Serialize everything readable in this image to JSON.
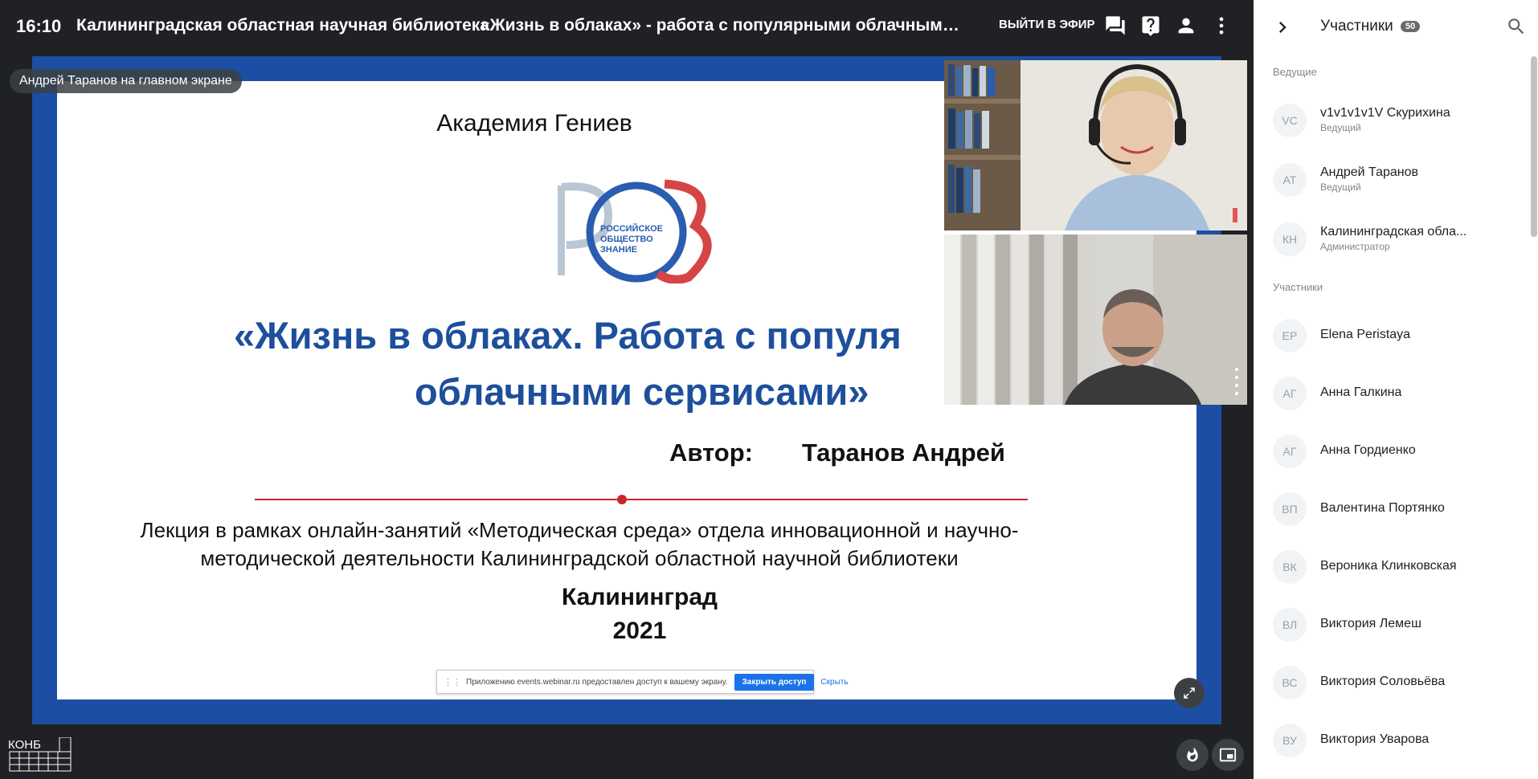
{
  "topbar": {
    "time": "16:10",
    "organization": "Калининградская областная научная библиотека",
    "event_title": "«Жизнь в облаках» - работа с популярными облачными сер...",
    "go_live": "ВЫЙТИ В ЭФИР",
    "icons": [
      "chat-icon",
      "question-icon",
      "person-icon",
      "more-vert-icon"
    ]
  },
  "stage": {
    "presenter_badge": "Андрей Таранов на главном экране",
    "slide": {
      "academy": "Академия Гениев",
      "logo_text": [
        "РОССИЙСКОЕ",
        "ОБЩЕСТВО",
        "ЗНАНИЕ"
      ],
      "title_line1": "«Жизнь в облаках. Работа с популя",
      "title_line2": "облачными сервисами»",
      "author_label": "Автор:",
      "author": "Таранов Андрей",
      "lecture": "Лекция в рамках онлайн-занятий «Методическая среда» отдела инновационной и научно-методической деятельности Калининградской областной научной библиотеки",
      "city": "Калининград",
      "year": "2021"
    },
    "share_bar": {
      "text": "Приложению events.webinar.ru предоставлен доступ к вашему экрану.",
      "stop": "Закрыть доступ",
      "hide": "Скрыть"
    }
  },
  "footer": {
    "logo_text": "КОНБ"
  },
  "sidebar": {
    "title": "Участники",
    "count": "50",
    "hosts_label": "Ведущие",
    "participants_label": "Участники",
    "hosts": [
      {
        "initials": "VC",
        "name": "v1v1v1v1V Скурихина",
        "role": "Ведущий"
      },
      {
        "initials": "АТ",
        "name": "Андрей Таранов",
        "role": "Ведущий"
      },
      {
        "initials": "КН",
        "name": "Калининградская обла...",
        "role": "Администратор"
      }
    ],
    "participants": [
      {
        "initials": "EP",
        "name": "Elena Peristaya"
      },
      {
        "initials": "АГ",
        "name": "Анна Галкина"
      },
      {
        "initials": "АГ",
        "name": "Анна Гордиенко"
      },
      {
        "initials": "ВП",
        "name": "Валентина Портянко"
      },
      {
        "initials": "ВК",
        "name": "Вероника Клинковская"
      },
      {
        "initials": "ВЛ",
        "name": "Виктория Лемеш"
      },
      {
        "initials": "ВС",
        "name": "Виктория Соловьёва"
      },
      {
        "initials": "ВУ",
        "name": "Виктория Уварова"
      }
    ]
  }
}
